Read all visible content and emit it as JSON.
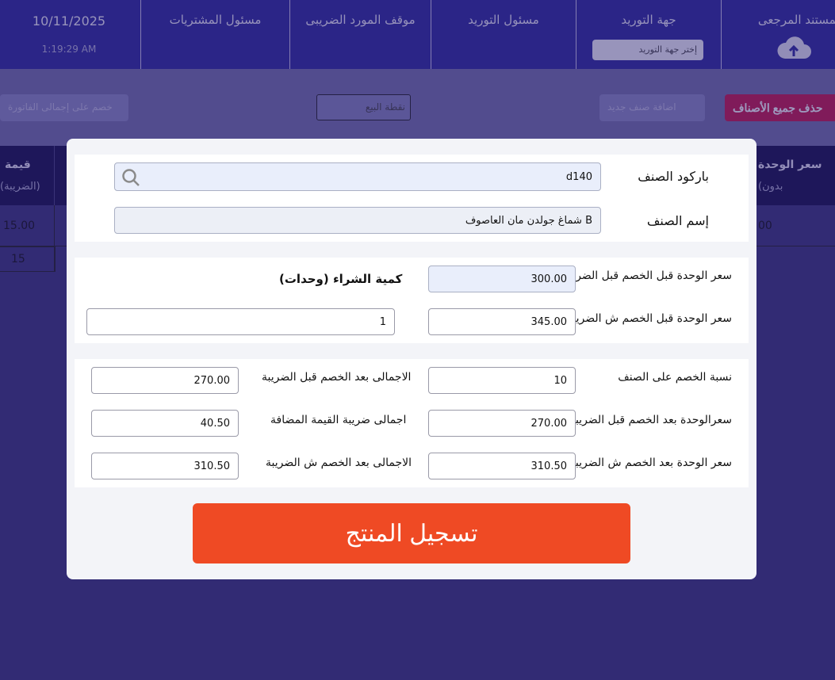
{
  "app": {
    "header": {
      "date": "10/11/2025",
      "time": "1:19:29 AM",
      "reference_doc_label": "المستند المرجعى",
      "supplier_label": "جهة التوريد",
      "supplier_placeholder": "إختر جهة التوريد",
      "supply_officer_label": "مسئول التوريد",
      "tax_status_label": "موقف المورد الضريبى",
      "purchase_officer_label": "مسئول المشتريات"
    },
    "toolbar": {
      "delete_all_label": "حذف جميع الأصناف",
      "faded_action_label": "اضافة صنف جديد",
      "sale_point_value": "نقطة البيع",
      "total_discount_label": "خصم على إجمالى الفاتورة"
    },
    "grid": {
      "col_unit_price": "سعر الوحدة",
      "col_unit_price_sub": "(بدون",
      "col_value": "قيمة",
      "col_value_sub": "(الضريبة)",
      "row1_value": "15.00",
      "row1_unit": "00",
      "row2_value": "15"
    }
  },
  "modal": {
    "barcode_label": "باركود الصنف",
    "barcode_value": "d140",
    "item_name_label": "إسم الصنف",
    "item_name_value": "شماغ جولدن مان العاصوف B",
    "unit_price_before_discount_before_tax_label": "سعر الوحدة قبل الخصم قبل الضريبة",
    "unit_price_before_discount_before_tax_value": "300.00",
    "purchase_qty_label": "كمية الشراء (وحدات)",
    "unit_price_before_discount_with_tax_label": "سعر الوحدة قبل الخصم ش الضريبة",
    "unit_price_before_discount_with_tax_value": "345.00",
    "purchase_qty_value": "1",
    "discount_pct_label": "نسبة الخصم على الصنف",
    "discount_pct_value": "10",
    "total_after_discount_before_tax_label": "الاجمالى بعد الخصم قبل الضريبة",
    "total_after_discount_before_tax_value": "270.00",
    "unit_after_discount_before_tax_label": "سعرالوحدة بعد الخصم قبل الضريبة",
    "unit_after_discount_before_tax_value": "270.00",
    "vat_total_label": "اجمالى ضريبة القيمة المضافة",
    "vat_total_value": "40.50",
    "unit_after_discount_with_tax_label": "سعر الوحدة بعد الخصم ش الضريبة",
    "unit_after_discount_with_tax_value": "310.50",
    "total_after_discount_with_tax_label": "الاجمالى بعد الخصم ش الضريبة",
    "total_after_discount_with_tax_value": "310.50",
    "submit_label": "تسجيل المنتج"
  }
}
